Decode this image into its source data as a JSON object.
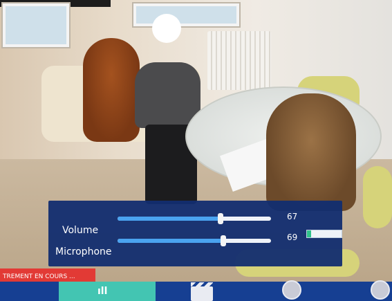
{
  "overlay": {
    "volume": {
      "label": "Volume",
      "value": "67",
      "level": 67
    },
    "microphone": {
      "label": "Microphone",
      "value": "69",
      "level": 69,
      "meter_level": 0.12
    },
    "accent": "#4aa3f0",
    "panel_color": "#122d70"
  },
  "status": {
    "recording_text": "TREMENT EN COURS ...",
    "color": "#e23a35"
  },
  "bottom_bar": {
    "active_tab_label": "ıll",
    "icons": [
      "clapperboard-icon",
      "disc-icon",
      "disc-icon"
    ]
  }
}
